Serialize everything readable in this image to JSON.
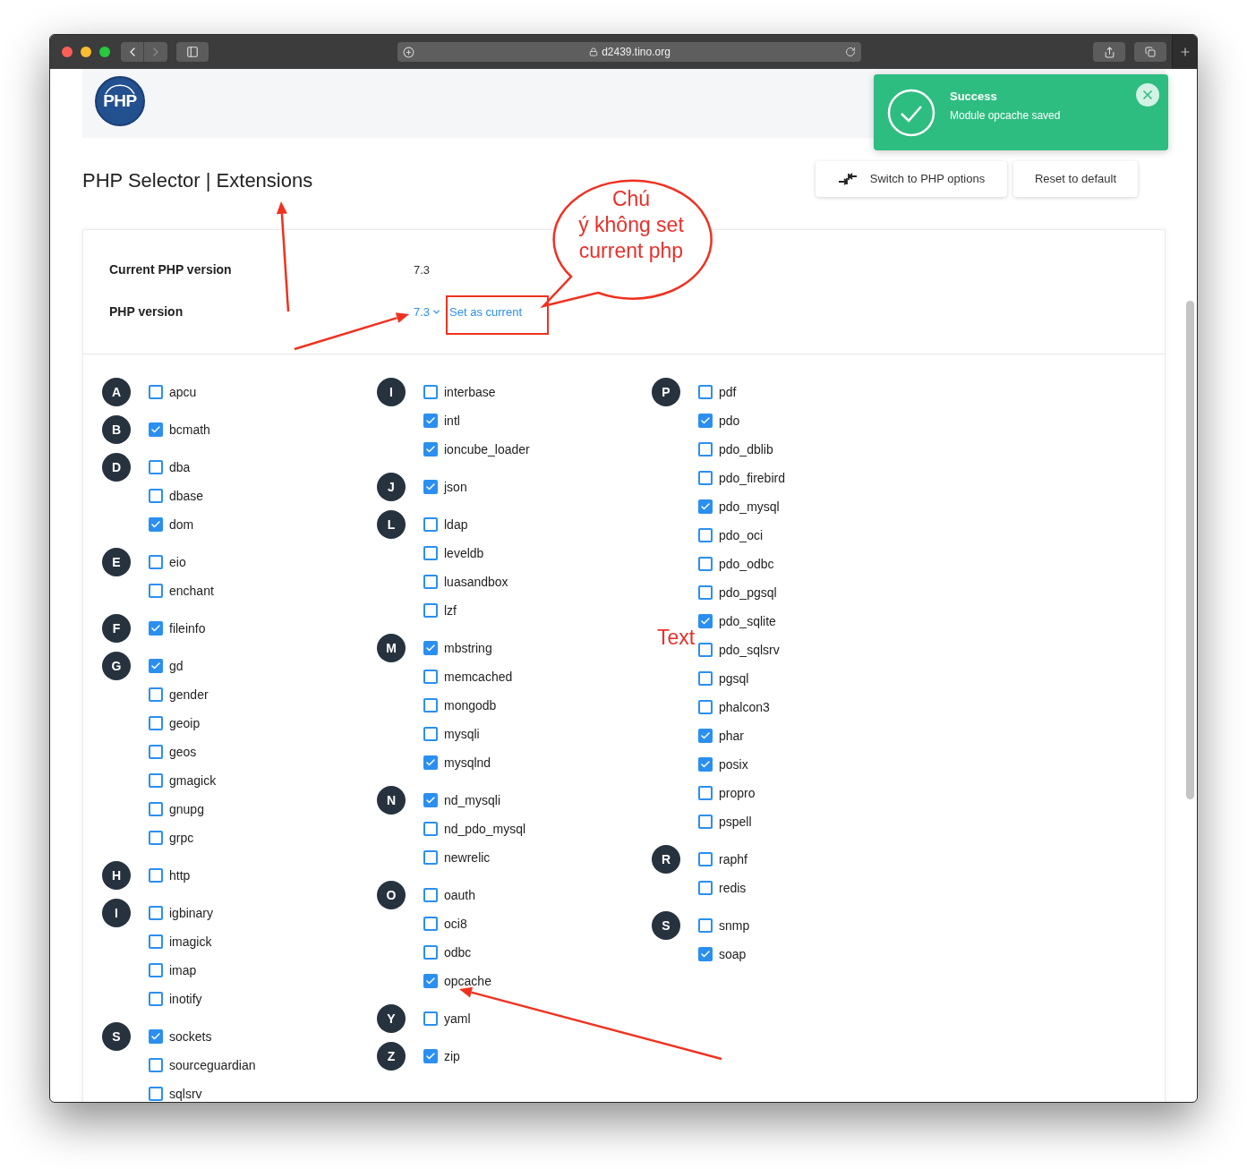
{
  "browser": {
    "address": "d2439.tino.org"
  },
  "logo": {
    "text": "PHP"
  },
  "toast": {
    "title": "Success",
    "message": "Module opcache saved"
  },
  "page_title": "PHP Selector | Extensions",
  "buttons": [
    {
      "label": "Switch to PHP options",
      "kind": "switch"
    },
    {
      "label": "Reset to default",
      "kind": "plain"
    }
  ],
  "version_info": {
    "current_label": "Current PHP version",
    "current_value": "7.3",
    "version_label": "PHP version",
    "version_value": "7.3",
    "set_current_link": "Set as current"
  },
  "extension_columns": [
    [
      {
        "letter": "A",
        "items": [
          {
            "name": "apcu",
            "checked": false
          }
        ]
      },
      {
        "letter": "B",
        "items": [
          {
            "name": "bcmath",
            "checked": true
          }
        ]
      },
      {
        "letter": "D",
        "items": [
          {
            "name": "dba",
            "checked": false
          },
          {
            "name": "dbase",
            "checked": false
          },
          {
            "name": "dom",
            "checked": true
          }
        ]
      },
      {
        "letter": "E",
        "items": [
          {
            "name": "eio",
            "checked": false
          },
          {
            "name": "enchant",
            "checked": false
          }
        ]
      },
      {
        "letter": "F",
        "items": [
          {
            "name": "fileinfo",
            "checked": true
          }
        ]
      },
      {
        "letter": "G",
        "items": [
          {
            "name": "gd",
            "checked": true
          },
          {
            "name": "gender",
            "checked": false
          },
          {
            "name": "geoip",
            "checked": false
          },
          {
            "name": "geos",
            "checked": false
          },
          {
            "name": "gmagick",
            "checked": false
          },
          {
            "name": "gnupg",
            "checked": false
          },
          {
            "name": "grpc",
            "checked": false
          }
        ]
      },
      {
        "letter": "H",
        "items": [
          {
            "name": "http",
            "checked": false
          }
        ]
      },
      {
        "letter": "I",
        "items": [
          {
            "name": "igbinary",
            "checked": false
          },
          {
            "name": "imagick",
            "checked": false
          },
          {
            "name": "imap",
            "checked": false
          },
          {
            "name": "inotify",
            "checked": false
          }
        ]
      },
      {
        "letter": "S",
        "items": [
          {
            "name": "sockets",
            "checked": true
          },
          {
            "name": "sourceguardian",
            "checked": false
          },
          {
            "name": "sqlsrv",
            "checked": false
          }
        ]
      }
    ],
    [
      {
        "letter": "I",
        "items": [
          {
            "name": "interbase",
            "checked": false
          },
          {
            "name": "intl",
            "checked": true
          },
          {
            "name": "ioncube_loader",
            "checked": true
          }
        ]
      },
      {
        "letter": "J",
        "items": [
          {
            "name": "json",
            "checked": true
          }
        ]
      },
      {
        "letter": "L",
        "items": [
          {
            "name": "ldap",
            "checked": false
          },
          {
            "name": "leveldb",
            "checked": false
          },
          {
            "name": "luasandbox",
            "checked": false
          },
          {
            "name": "lzf",
            "checked": false
          }
        ]
      },
      {
        "letter": "M",
        "items": [
          {
            "name": "mbstring",
            "checked": true
          },
          {
            "name": "memcached",
            "checked": false
          },
          {
            "name": "mongodb",
            "checked": false
          },
          {
            "name": "mysqli",
            "checked": false
          },
          {
            "name": "mysqlnd",
            "checked": true
          }
        ]
      },
      {
        "letter": "N",
        "items": [
          {
            "name": "nd_mysqli",
            "checked": true
          },
          {
            "name": "nd_pdo_mysql",
            "checked": false
          },
          {
            "name": "newrelic",
            "checked": false
          }
        ]
      },
      {
        "letter": "O",
        "items": [
          {
            "name": "oauth",
            "checked": false
          },
          {
            "name": "oci8",
            "checked": false
          },
          {
            "name": "odbc",
            "checked": false
          },
          {
            "name": "opcache",
            "checked": true
          }
        ]
      },
      {
        "letter": "Y",
        "items": [
          {
            "name": "yaml",
            "checked": false
          }
        ]
      },
      {
        "letter": "Z",
        "items": [
          {
            "name": "zip",
            "checked": true
          }
        ]
      }
    ],
    [
      {
        "letter": "P",
        "items": [
          {
            "name": "pdf",
            "checked": false
          },
          {
            "name": "pdo",
            "checked": true
          },
          {
            "name": "pdo_dblib",
            "checked": false
          },
          {
            "name": "pdo_firebird",
            "checked": false
          },
          {
            "name": "pdo_mysql",
            "checked": true
          },
          {
            "name": "pdo_oci",
            "checked": false
          },
          {
            "name": "pdo_odbc",
            "checked": false
          },
          {
            "name": "pdo_pgsql",
            "checked": false
          },
          {
            "name": "pdo_sqlite",
            "checked": true
          },
          {
            "name": "pdo_sqlsrv",
            "checked": false
          },
          {
            "name": "pgsql",
            "checked": false
          },
          {
            "name": "phalcon3",
            "checked": false
          },
          {
            "name": "phar",
            "checked": true
          },
          {
            "name": "posix",
            "checked": true
          },
          {
            "name": "propro",
            "checked": false
          },
          {
            "name": "pspell",
            "checked": false
          }
        ]
      },
      {
        "letter": "R",
        "items": [
          {
            "name": "raphf",
            "checked": false
          },
          {
            "name": "redis",
            "checked": false
          }
        ]
      },
      {
        "letter": "S",
        "items": [
          {
            "name": "snmp",
            "checked": false
          },
          {
            "name": "soap",
            "checked": true
          }
        ]
      }
    ]
  ],
  "annotations": {
    "callout_lines": [
      "Chú",
      "ý không set",
      "current php"
    ],
    "label": "Text"
  }
}
